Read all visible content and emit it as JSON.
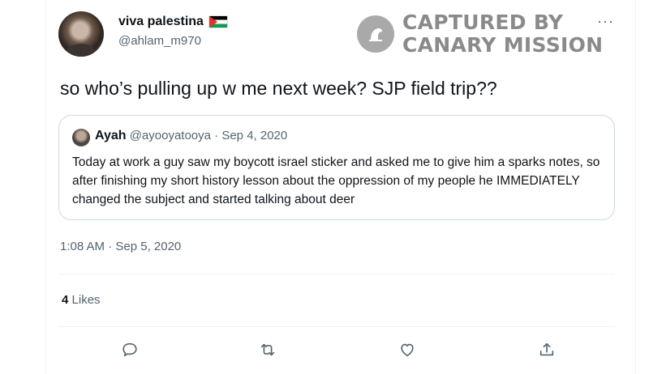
{
  "tweet": {
    "display_name": "viva palestina",
    "handle": "@ahlam_m970",
    "text": "so who’s pulling up w me next week? SJP field trip??",
    "timestamp": "1:08 AM · Sep 5, 2020",
    "likes_count": "4",
    "likes_label": "Likes",
    "more_label": "···"
  },
  "quoted_tweet": {
    "name": "Ayah",
    "handle": "@ayooyatooya",
    "date": "· Sep 4, 2020",
    "text": "Today at work a guy saw my boycott israel sticker and asked me to give him a sparks notes, so after finishing my short history lesson about the oppression of my people he IMMEDIATELY changed the subject and started talking about deer"
  },
  "watermark": {
    "line1": "CAPTURED BY",
    "line2": "CANARY MISSION"
  },
  "actions": [
    {
      "icon": "reply-icon"
    },
    {
      "icon": "retweet-icon"
    },
    {
      "icon": "like-icon"
    },
    {
      "icon": "share-icon"
    }
  ],
  "colors": {
    "text_primary": "#0f1419",
    "text_secondary": "#536471",
    "border": "#cfd9de",
    "watermark": "#8a8a8a"
  }
}
